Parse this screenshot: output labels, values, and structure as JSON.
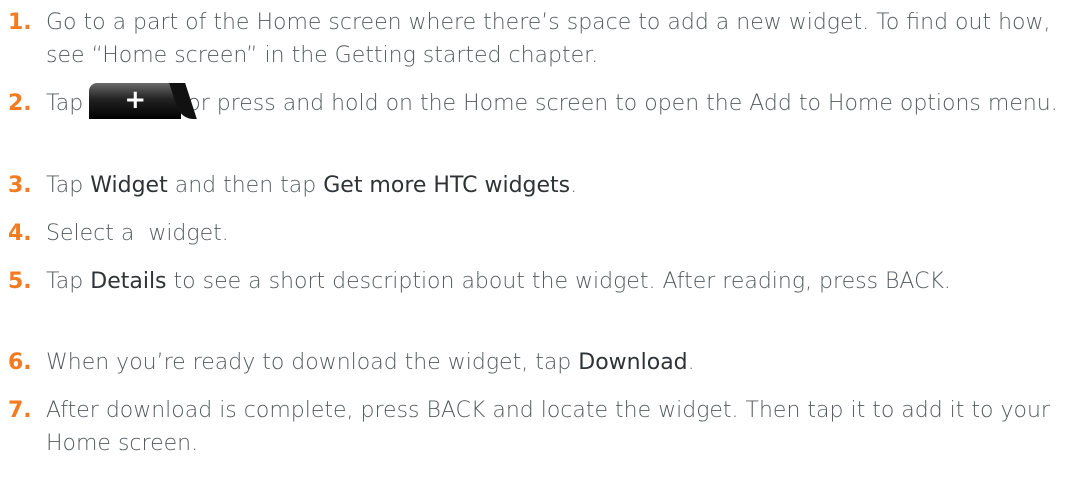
{
  "steps": [
    {
      "number": "1.",
      "text": "Go to a part of the Home screen where there’s space to add a new widget. To find out how, see “Home screen” in the Getting started chapter."
    },
    {
      "number": "2.",
      "before": "Tap",
      "button_icon": "plus-icon",
      "button_symbol": "+",
      "after": "or press and hold on the Home screen to open the Add to Home options menu."
    },
    {
      "number": "3.",
      "before": "Tap",
      "ui_1": "Widget",
      "middle": "and then tap",
      "ui_2": "Get more HTC widgets",
      "after": "."
    },
    {
      "number": "4.",
      "text": "Select a  widget."
    },
    {
      "number": "5.",
      "before": "Tap",
      "ui_1": "Details",
      "after": "to see a short description about the widget. After reading, press BACK."
    },
    {
      "number": "6.",
      "before": "When you’re ready to download the widget, tap",
      "ui_1": "Download",
      "after": "."
    },
    {
      "number": "7.",
      "text": "After download is complete, press BACK and locate the widget. Then tap it to add it to your Home screen."
    }
  ]
}
